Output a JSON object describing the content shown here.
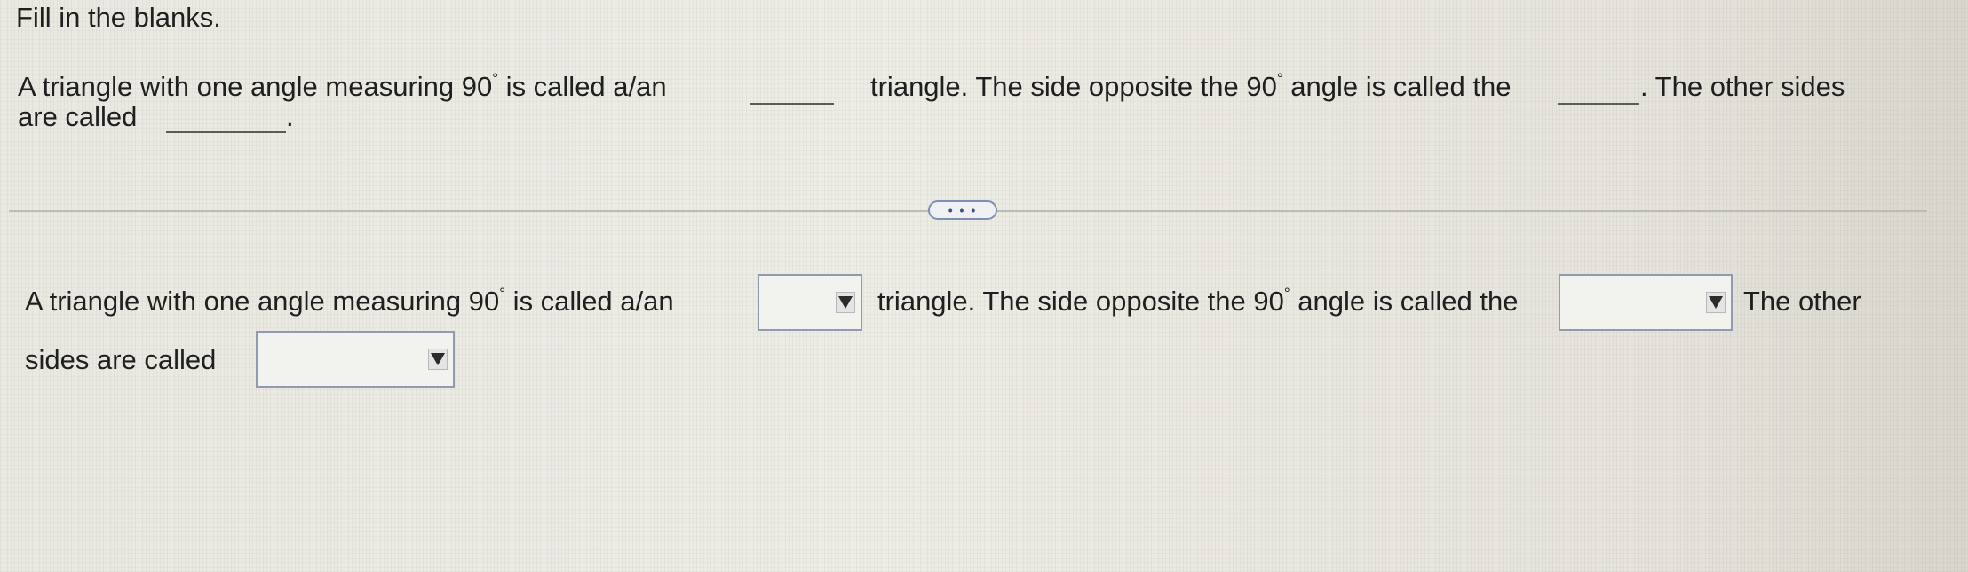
{
  "instructions": "Fill in the blanks.",
  "question": {
    "part1": "A triangle with one angle measuring 90",
    "degree": "°",
    "part2": " is called a/an",
    "part3": "triangle. The side opposite the 90",
    "part4": " angle is called the",
    "part5": ". The other sides",
    "part6": "are called",
    "part7": "."
  },
  "more_button": "• • •",
  "answer": {
    "part1": "A triangle with one angle measuring 90",
    "degree": "°",
    "part2": " is called a/an",
    "part3": "triangle. The side opposite the 90",
    "part4": " angle is called the",
    "part5": "The other",
    "part6": "sides are called",
    "dropdown1_value": "",
    "dropdown2_value": "",
    "dropdown3_value": ""
  },
  "icons": {
    "dropdown_arrow": "triangle-down-icon"
  }
}
